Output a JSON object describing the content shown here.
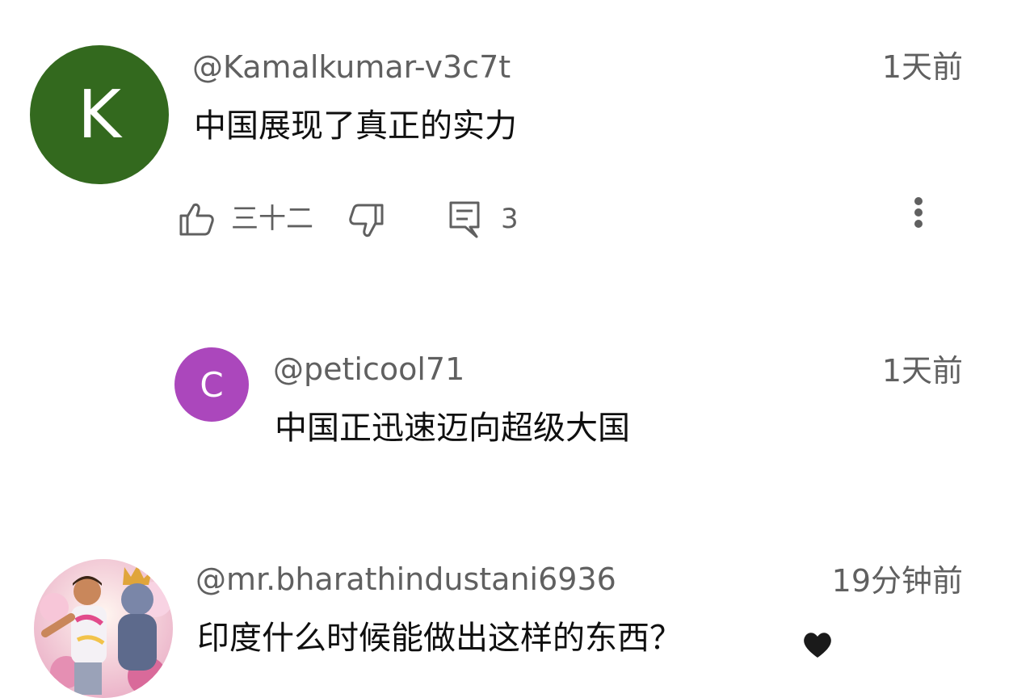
{
  "comments": [
    {
      "avatar_letter": "K",
      "username": "@Kamalkumar-v3c7t",
      "time": "1天前",
      "text": "中国展现了真正的实力",
      "likes": "三十二",
      "replies": "3",
      "avatar_color": "#33691e"
    },
    {
      "avatar_letter": "C",
      "username": "@peticool71",
      "time": "1天前",
      "text": "中国正迅速迈向超级大国",
      "avatar_color": "#ab47bc"
    },
    {
      "username": "@mr.bharathindustani6936",
      "time": "19分钟前",
      "text": "印度什么时候能做出这样的东西？",
      "trailing_icon": "heart-icon"
    }
  ]
}
